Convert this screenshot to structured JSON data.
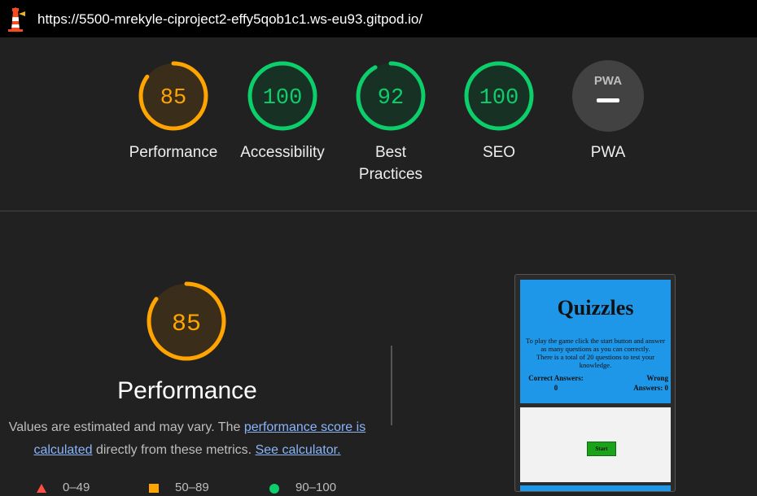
{
  "address_bar": {
    "url": "https://5500-mrekyle-ciproject2-effy5qob1c1.ws-eu93.gitpod.io/"
  },
  "gauges": [
    {
      "score": "85",
      "label": "Performance",
      "fraction": 0.85,
      "color": "#ffa400",
      "bg": "#3a2e1a"
    },
    {
      "score": "100",
      "label": "Accessibility",
      "fraction": 1.0,
      "color": "#0cce6b",
      "bg": "#173224"
    },
    {
      "score": "92",
      "label": "Best Practices",
      "label_line1": "Best",
      "label_line2": "Practices",
      "fraction": 0.92,
      "color": "#0cce6b",
      "bg": "#173224"
    },
    {
      "score": "100",
      "label": "SEO",
      "fraction": 1.0,
      "color": "#0cce6b",
      "bg": "#173224"
    },
    {
      "score": "PWA",
      "label": "PWA",
      "color": "#424242"
    }
  ],
  "performance_section": {
    "score": "85",
    "fraction": 0.85,
    "title": "Performance",
    "desc_prefix": "Values are estimated and may vary. The ",
    "link1": "performance score is calculated",
    "desc_mid": " directly from these metrics. ",
    "link2": "See calculator."
  },
  "legend": [
    {
      "range": "0–49",
      "shape": "triangle",
      "color": "#ff4e42"
    },
    {
      "range": "50–89",
      "shape": "square",
      "color": "#ffa400"
    },
    {
      "range": "90–100",
      "shape": "circle",
      "color": "#0cce6b"
    }
  ],
  "preview": {
    "title": "Quizzles",
    "intro_line1": "To play the game click the start button and answer",
    "intro_line2": "as many questions as you can correctly.",
    "intro_line3": "There is a total of 20 questions to test your",
    "intro_line4": "knowledge.",
    "correct_label": "Correct Answers:",
    "correct_value": "0",
    "wrong_label_1": "Wrong",
    "wrong_label_2": "Answers: 0",
    "start_label": "Start"
  }
}
